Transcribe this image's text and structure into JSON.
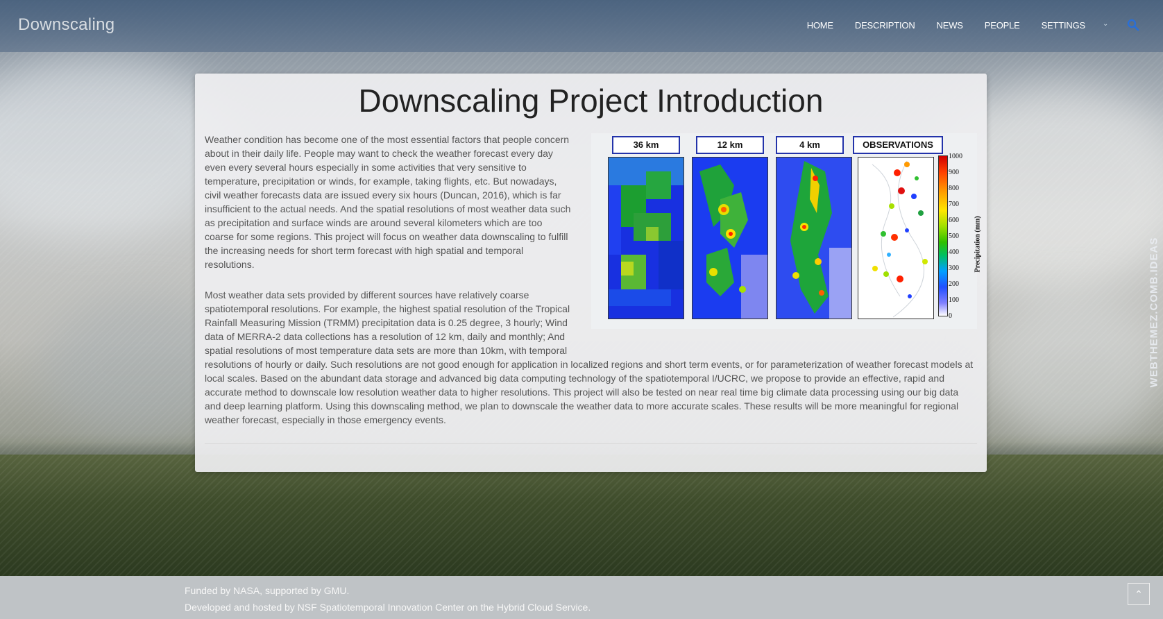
{
  "nav": {
    "brand": "Downscaling",
    "items": [
      "HOME",
      "DESCRIPTION",
      "NEWS",
      "PEOPLE",
      "SETTINGS"
    ]
  },
  "content": {
    "title": "Downscaling Project Introduction",
    "paragraph1": "Weather condition has become one of the most essential factors that people concern about in their daily life. People may want to check the weather forecast every day even every several hours especially in some activities that very sensitive to temperature, precipitation or winds, for example, taking flights, etc. But nowadays, civil weather forecasts data are issued every six hours (Duncan, 2016), which is far insufficient to the actual needs. And the spatial resolutions of most weather data such as precipitation and surface winds are around several kilometers which are too coarse for some regions. This project will focus on weather data downscaling to fulfill the increasing needs for short term forecast with high spatial and temporal resolutions.",
    "paragraph2": "Most weather data sets provided by different sources have relatively coarse spatiotemporal resolutions. For example, the highest spatial resolution of the Tropical Rainfall Measuring Mission (TRMM) precipitation data is 0.25 degree, 3 hourly; Wind data of MERRA-2 data collections has a resolution of 12 km, daily and monthly; And spatial resolutions of most temperature data sets are more than 10km, with temporal resolutions of hourly or daily. Such resolutions are not good enough for application in localized regions and short term events, or for parameterization of weather forecast models at local scales. Based on the abundant data storage and advanced big data computing technology of the spatiotemporal I/UCRC, we propose to provide an effective, rapid and accurate method to downscale low resolution weather data to higher resolutions. This project will also be tested on near real time big climate data processing using our big data and deep learning platform. Using this downscaling method, we plan to downscale the weather data to more accurate scales. These results will be more meaningful for regional weather forecast, especially in those emergency events."
  },
  "figure": {
    "panel_labels": [
      "36 km",
      "12 km",
      "4 km",
      "OBSERVATIONS"
    ],
    "colorbar_title": "Precipitation (mm)",
    "colorbar_ticks": [
      "1000",
      "900",
      "800",
      "700",
      "600",
      "500",
      "400",
      "300",
      "200",
      "100",
      "0"
    ]
  },
  "side_text": "WEBTHEMEZ.COMB.IDEAS",
  "footer": {
    "line1": "Funded by NASA, supported by GMU.",
    "line2": "Developed and hosted by NSF Spatiotemporal Innovation Center on the Hybrid Cloud Service."
  },
  "icons": {
    "search": "search-icon",
    "settings_caret": "chevron-down-icon",
    "back_to_top": "chevron-up-icon"
  },
  "colors": {
    "accent": "#2a6fd6",
    "panel_border": "#2333aa"
  }
}
